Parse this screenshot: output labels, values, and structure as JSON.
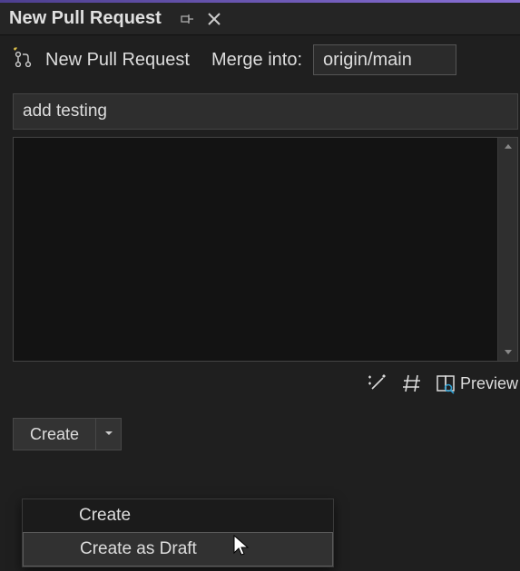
{
  "header": {
    "title": "New Pull Request"
  },
  "toolbar": {
    "title": "New Pull Request",
    "merge_label": "Merge into:",
    "target_branch": "origin/main"
  },
  "form": {
    "title_value": "add testing",
    "title_placeholder": "Enter a title",
    "description_value": "",
    "description_placeholder": ""
  },
  "tools": {
    "preview_label": "Preview"
  },
  "create": {
    "button_label": "Create",
    "menu": {
      "item_create": "Create",
      "item_draft": "Create as Draft"
    }
  }
}
